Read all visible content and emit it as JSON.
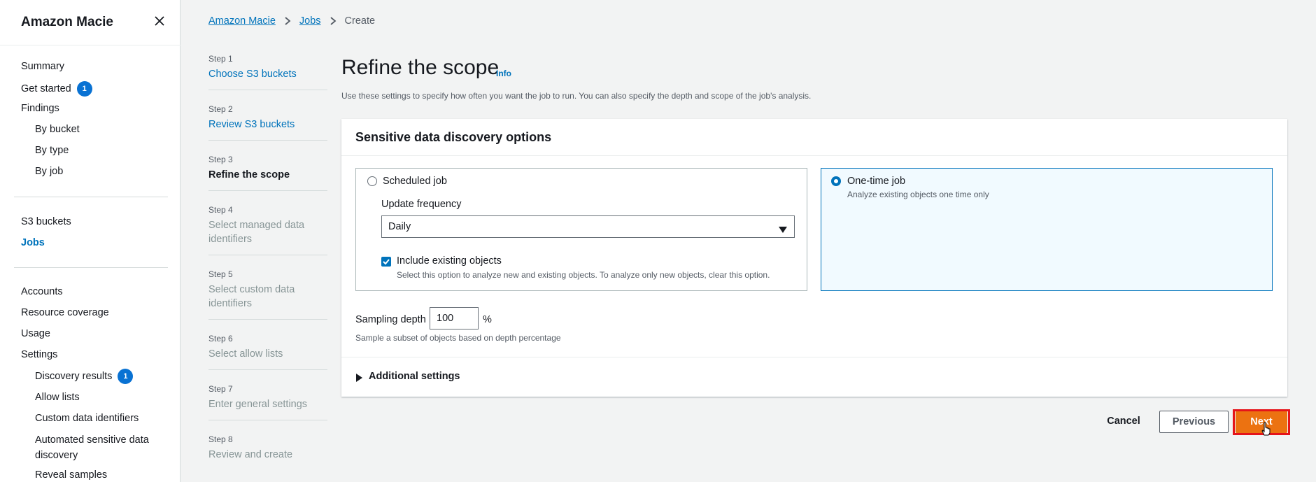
{
  "sidebar": {
    "title": "Amazon Macie",
    "items": [
      {
        "label": "Summary"
      },
      {
        "label": "Get started",
        "badge": "1"
      },
      {
        "label": "Findings"
      },
      {
        "label": "By bucket"
      },
      {
        "label": "By type"
      },
      {
        "label": "By job"
      },
      {
        "label": "S3 buckets"
      },
      {
        "label": "Jobs"
      },
      {
        "label": "Accounts"
      },
      {
        "label": "Resource coverage"
      },
      {
        "label": "Usage"
      },
      {
        "label": "Settings"
      },
      {
        "label": "Discovery results",
        "badge": "1"
      },
      {
        "label": "Allow lists"
      },
      {
        "label": "Custom data identifiers"
      },
      {
        "label": "Automated sensitive data discovery"
      },
      {
        "label": "Reveal samples"
      }
    ]
  },
  "breadcrumb": {
    "items": [
      "Amazon Macie",
      "Jobs",
      "Create"
    ]
  },
  "steps": [
    {
      "num": "Step 1",
      "title": "Choose S3 buckets"
    },
    {
      "num": "Step 2",
      "title": "Review S3 buckets"
    },
    {
      "num": "Step 3",
      "title": "Refine the scope"
    },
    {
      "num": "Step 4",
      "title": "Select managed data identifiers"
    },
    {
      "num": "Step 5",
      "title": "Select custom data identifiers"
    },
    {
      "num": "Step 6",
      "title": "Select allow lists"
    },
    {
      "num": "Step 7",
      "title": "Enter general settings"
    },
    {
      "num": "Step 8",
      "title": "Review and create"
    }
  ],
  "main": {
    "title": "Refine the scope",
    "info": "Info",
    "description": "Use these settings to specify how often you want the job to run. You can also specify the depth and scope of the job's analysis.",
    "container_title": "Sensitive data discovery options",
    "scheduled": {
      "label": "Scheduled job",
      "frequency_label": "Update frequency",
      "frequency_value": "Daily",
      "include_label": "Include existing objects",
      "include_desc": "Select this option to analyze new and existing objects. To analyze only new objects, clear this option."
    },
    "onetime": {
      "label": "One-time job",
      "desc": "Analyze existing objects one time only"
    },
    "sampling": {
      "label": "Sampling depth",
      "value": "100",
      "unit": "%",
      "desc": "Sample a subset of objects based on depth percentage"
    },
    "additional": "Additional settings"
  },
  "actions": {
    "cancel": "Cancel",
    "previous": "Previous",
    "next": "Next"
  },
  "colors": {
    "link": "#0073bb",
    "primary": "#ec7211",
    "highlight": "#e5141a"
  }
}
